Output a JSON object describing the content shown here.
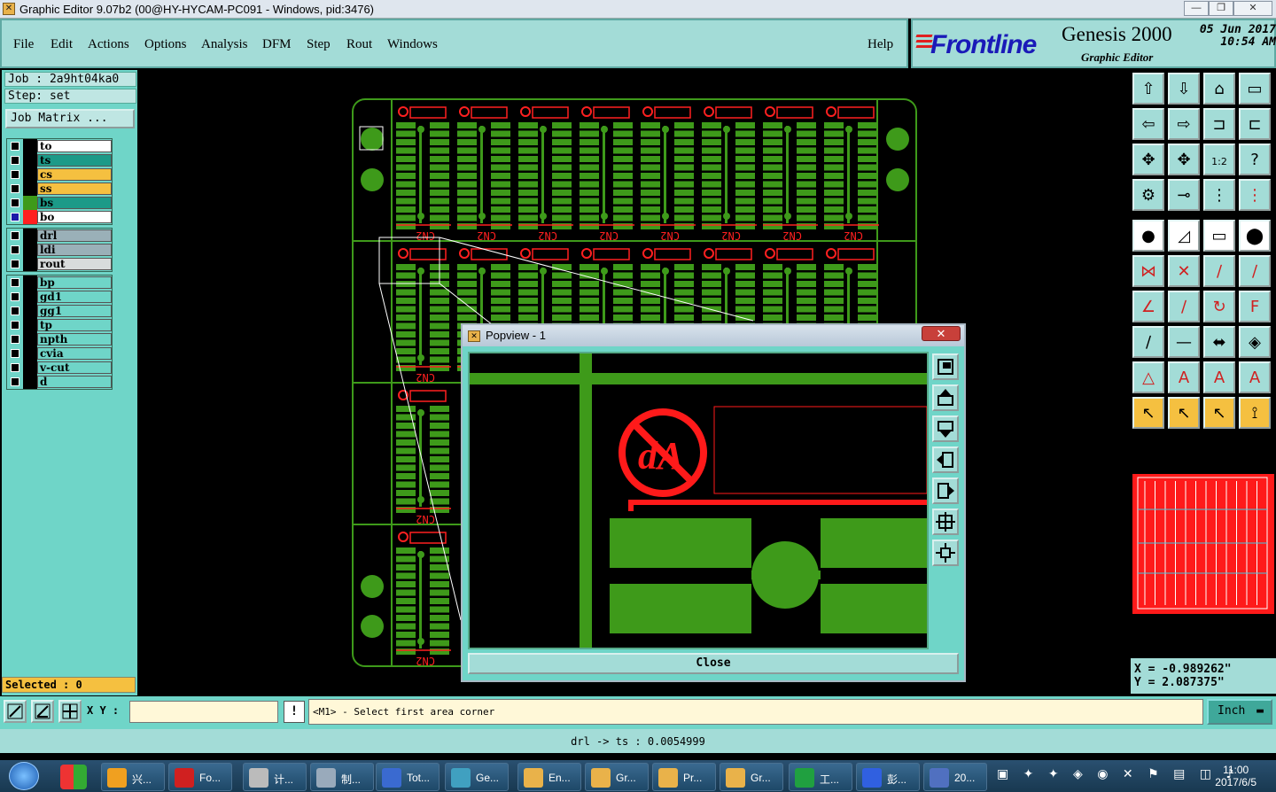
{
  "window": {
    "title": "Graphic Editor 9.07b2 (00@HY-HYCAM-PC091 - Windows, pid:3476)"
  },
  "menu": [
    "File",
    "Edit",
    "Actions",
    "Options",
    "Analysis",
    "DFM",
    "Step",
    "Rout",
    "Windows"
  ],
  "help": "Help",
  "brand": {
    "logo": "Frontline",
    "product": "Genesis 2000",
    "subtitle": "Graphic Editor",
    "date": "05 Jun 2017",
    "time": "10:54 AM"
  },
  "job": {
    "job": "Job : 2a9ht04ka0",
    "step": "Step: set",
    "matrix": "Job Matrix ..."
  },
  "layers_board": [
    "to",
    "ts",
    "cs",
    "ss",
    "bs",
    "bo"
  ],
  "layers_drill": [
    "drl",
    "ldi",
    "rout"
  ],
  "layers_misc": [
    "bp",
    "gd1",
    "gg1",
    "tp",
    "npth",
    "cvia",
    "v-cut",
    "d"
  ],
  "selected": "Selected : 0",
  "board": {
    "label": "CN2"
  },
  "popview": {
    "title": "Popview - 1",
    "close": "Close"
  },
  "coords": {
    "x": "X = -0.989262\"",
    "y": "Y = 2.087375\""
  },
  "cmd": {
    "xy": "X Y :",
    "prompt": "<M1> - Select first area corner",
    "unit": "Inch",
    "excl": "!"
  },
  "status": "drl -> ts : 0.0054999",
  "taskbar": {
    "items": [
      "兴...",
      "Fo...",
      "计...",
      "制...",
      "Tot...",
      "Ge...",
      "En...",
      "Gr...",
      "Pr...",
      "Gr...",
      "工...",
      "彭...",
      "20..."
    ],
    "time": "11:00",
    "date": "2017/6/5"
  },
  "colors": {
    "panel": "#6fd5c8",
    "menu": "#a3dcd7",
    "copper": "#3e9a1a",
    "silk": "#ff2020",
    "accent": "#f5c040"
  }
}
